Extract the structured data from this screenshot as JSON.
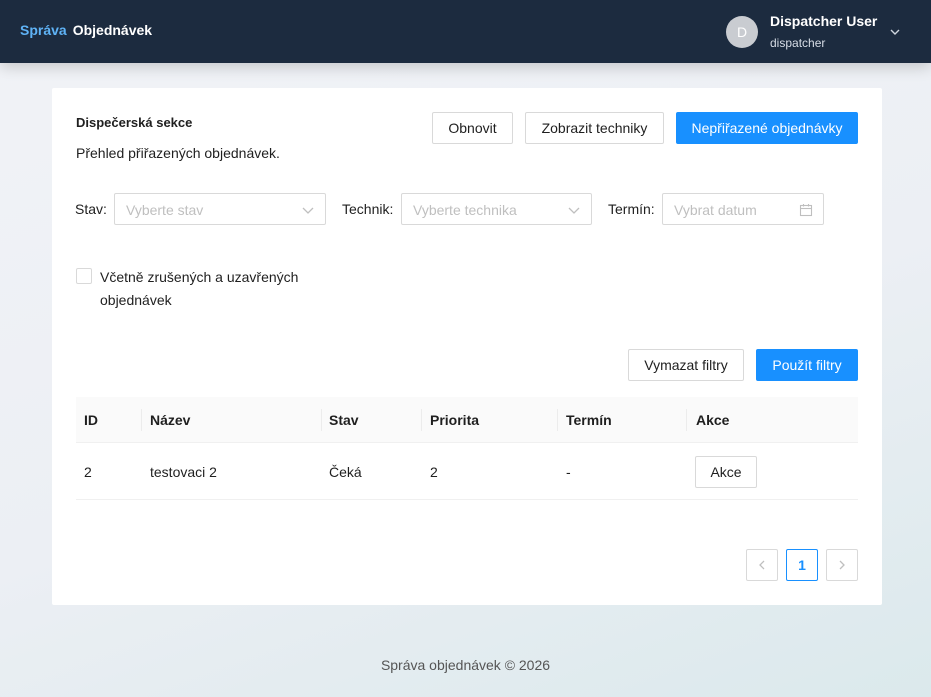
{
  "header": {
    "brand_part1": "Správa",
    "brand_part2": "Objednávek",
    "user": {
      "initial": "D",
      "name": "Dispatcher User",
      "role": "dispatcher"
    }
  },
  "section": {
    "title": "Dispečerská sekce",
    "subtitle": "Přehled přiřazených objednávek."
  },
  "actions": {
    "refresh": "Obnovit",
    "show_technicians": "Zobrazit techniky",
    "unassigned_orders": "Nepřiřazené objednávky"
  },
  "filters": {
    "status": {
      "label": "Stav",
      "placeholder": "Vyberte stav"
    },
    "technician": {
      "label": "Technik",
      "placeholder": "Vyberte technika"
    },
    "date": {
      "label": "Termín",
      "placeholder": "Vybrat datum"
    },
    "include_closed": {
      "label": "Včetně zrušených a uzavřených objednávek",
      "checked": false
    },
    "clear": "Vymazat filtry",
    "apply": "Použít filtry"
  },
  "table": {
    "columns": [
      "ID",
      "Název",
      "Stav",
      "Priorita",
      "Termín",
      "Akce"
    ],
    "rows": [
      {
        "id": "2",
        "name": "testovaci 2",
        "status": "Čeká",
        "priority": "2",
        "date": "-",
        "action": "Akce"
      }
    ]
  },
  "pagination": {
    "current": "1"
  },
  "footer": "Správa objednávek © 2026",
  "colors": {
    "header_bg": "#1c2b3f",
    "primary": "#1890ff",
    "brand_accent": "#5fb3f6"
  }
}
